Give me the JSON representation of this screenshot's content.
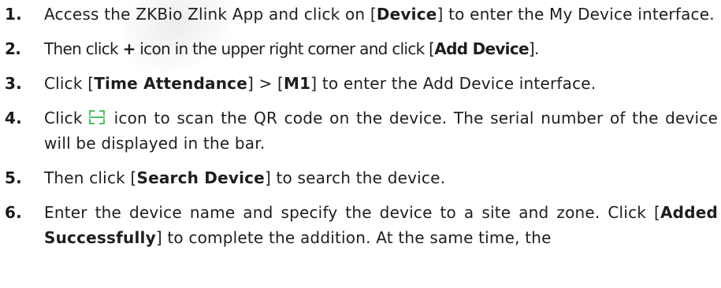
{
  "steps": [
    {
      "number": "1.",
      "parts": [
        {
          "text": "Access the ZKBio Zlink App and click on [",
          "bold": false
        },
        {
          "text": "Device",
          "bold": true
        },
        {
          "text": "] to enter the My Device interface.",
          "bold": false
        }
      ]
    },
    {
      "number": "2.",
      "parts": [
        {
          "text": "Then click ",
          "bold": false
        },
        {
          "text": "+",
          "bold": true
        },
        {
          "text": " icon in the upper right corner and click [",
          "bold": false
        },
        {
          "text": "Add Device",
          "bold": true
        },
        {
          "text": "].",
          "bold": false
        }
      ]
    },
    {
      "number": "3.",
      "parts": [
        {
          "text": "Click [",
          "bold": false
        },
        {
          "text": "Time Attendance",
          "bold": true
        },
        {
          "text": "] > [",
          "bold": false
        },
        {
          "text": "M1",
          "bold": true
        },
        {
          "text": "] to enter the Add Device interface.",
          "bold": false
        }
      ]
    },
    {
      "number": "4.",
      "before_icon": "Click",
      "icon": "scan-qr-icon",
      "icon_color": "#3cb54a",
      "after_icon": "icon to scan the QR code on the device. The serial number of the device will be displayed in the bar."
    },
    {
      "number": "5.",
      "parts": [
        {
          "text": "Then click [",
          "bold": false
        },
        {
          "text": "Search Device",
          "bold": true
        },
        {
          "text": "] to search the device.",
          "bold": false
        }
      ]
    },
    {
      "number": "6.",
      "parts": [
        {
          "text": "Enter the device name and specify the device to a site and zone. Click [",
          "bold": false
        },
        {
          "text": "Added Successfully",
          "bold": true
        },
        {
          "text": "] to complete the addition. At the same time, the",
          "bold": false
        }
      ]
    }
  ]
}
